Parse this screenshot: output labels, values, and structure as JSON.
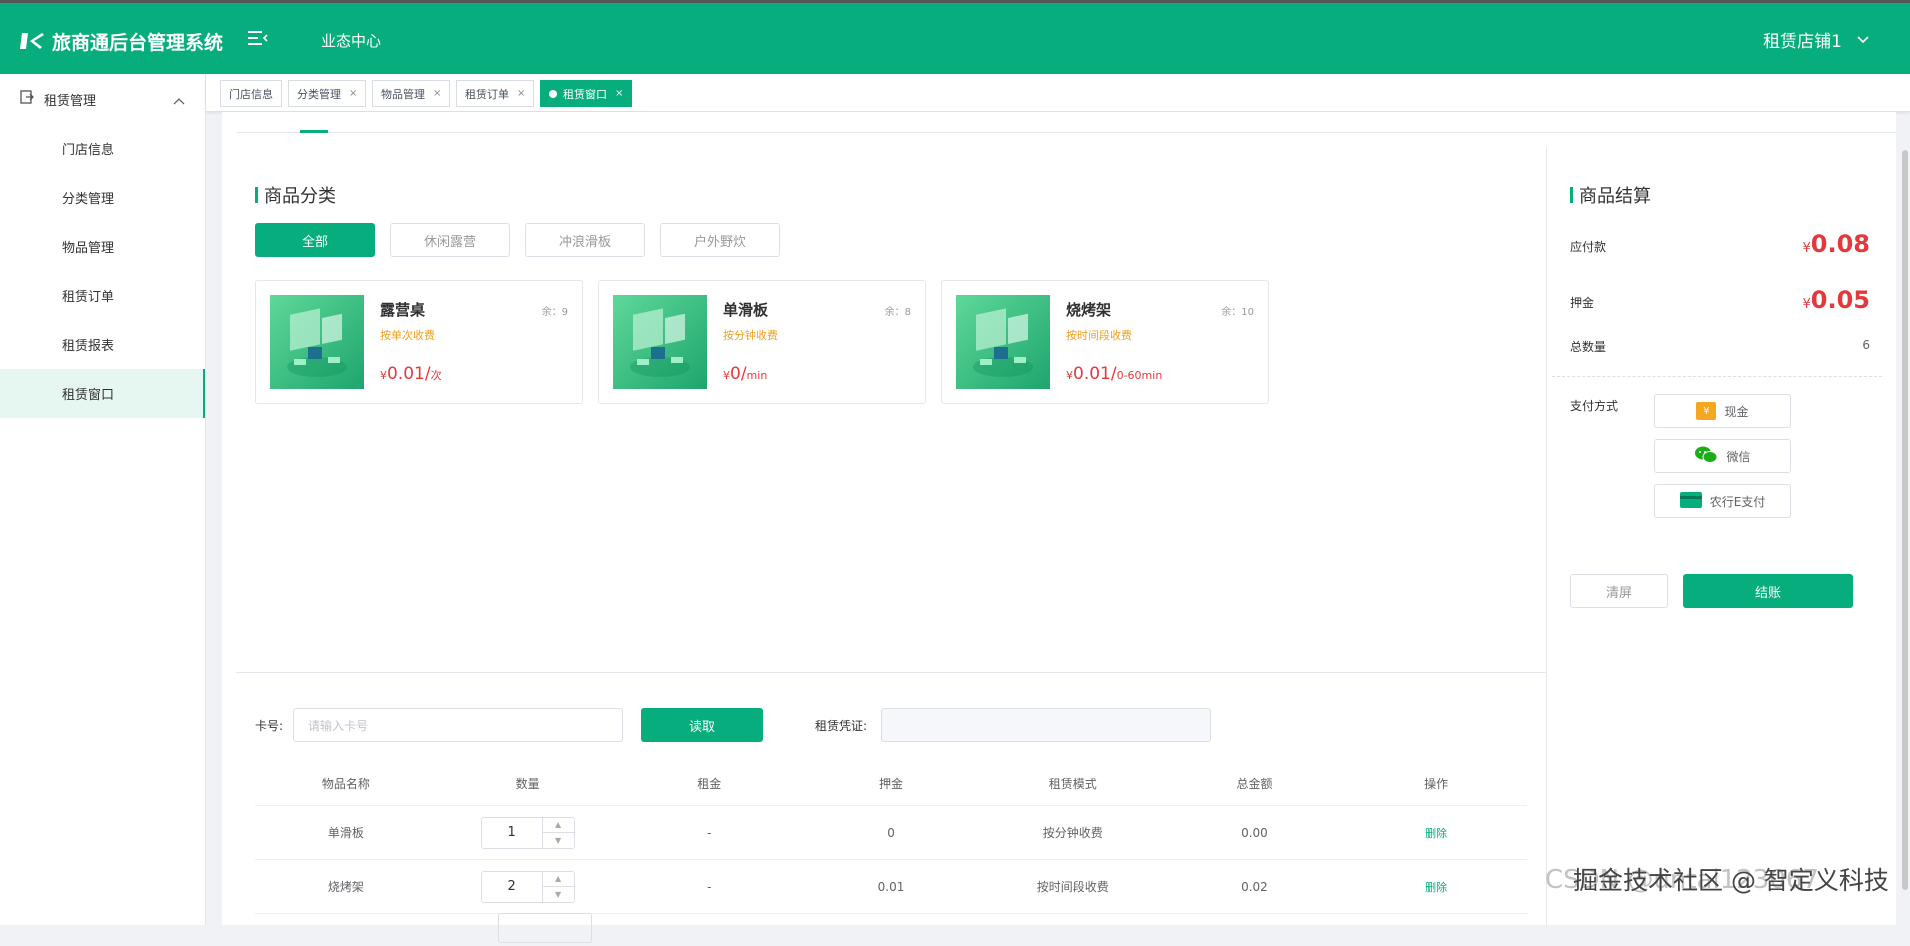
{
  "header": {
    "title": "旅商通后台管理系统",
    "nav_center": "业态中心",
    "user": "租赁店铺1"
  },
  "sidebar": {
    "group": "租赁管理",
    "items": [
      {
        "label": "门店信息"
      },
      {
        "label": "分类管理"
      },
      {
        "label": "物品管理"
      },
      {
        "label": "租赁订单"
      },
      {
        "label": "租赁报表"
      },
      {
        "label": "租赁窗口"
      }
    ],
    "active": "租赁窗口"
  },
  "tabs": [
    {
      "label": "门店信息",
      "closable": false
    },
    {
      "label": "分类管理",
      "closable": true
    },
    {
      "label": "物品管理",
      "closable": true
    },
    {
      "label": "租赁订单",
      "closable": true
    },
    {
      "label": "租赁窗口",
      "closable": true,
      "active": true
    }
  ],
  "goods": {
    "title": "商品分类",
    "categories": [
      "全部",
      "休闲露营",
      "冲浪滑板",
      "户外野炊"
    ],
    "active_category": "全部",
    "cards": [
      {
        "name": "露营桌",
        "stock": "余：9",
        "mode": "按单次收费",
        "currency": "¥",
        "price": "0.01/",
        "unit": "次"
      },
      {
        "name": "单滑板",
        "stock": "余：8",
        "mode": "按分钟收费",
        "currency": "¥",
        "price": "0/",
        "unit": "min"
      },
      {
        "name": "烧烤架",
        "stock": "余：10",
        "mode": "按时间段收费",
        "currency": "¥",
        "price": "0.01/",
        "unit": "0-60min"
      }
    ]
  },
  "form": {
    "card_label": "卡号:",
    "card_placeholder": "请输入卡号",
    "read_button": "读取",
    "voucher_label": "租赁凭证:"
  },
  "table": {
    "columns": [
      "物品名称",
      "数量",
      "租金",
      "押金",
      "租赁模式",
      "总金额",
      "操作"
    ],
    "rows": [
      {
        "name": "单滑板",
        "qty": "1",
        "rent": "-",
        "deposit": "0",
        "mode": "按分钟收费",
        "total": "0.00",
        "action": "删除"
      },
      {
        "name": "烧烤架",
        "qty": "2",
        "rent": "-",
        "deposit": "0.01",
        "mode": "按时间段收费",
        "total": "0.02",
        "action": "删除"
      }
    ]
  },
  "checkout": {
    "title": "商品结算",
    "payable_label": "应付款",
    "payable_currency": "¥",
    "payable_value": "0.08",
    "deposit_label": "押金",
    "deposit_currency": "¥",
    "deposit_value": "0.05",
    "count_label": "总数量",
    "count_value": "6",
    "pay_label": "支付方式",
    "pay_methods": [
      {
        "label": "现金",
        "icon": "cash-icon",
        "badge": "¥"
      },
      {
        "label": "微信",
        "icon": "wechat-icon"
      },
      {
        "label": "农行E支付",
        "icon": "bank-card-icon"
      }
    ],
    "clear_button": "清屏",
    "checkout_button": "结账"
  },
  "watermark": "掘金技术社区 @ 智定义科技",
  "watermark_bg": "CSDN @untal123067",
  "colors": {
    "accent": "#07ad7c",
    "price": "#e4393c",
    "mode": "#f0a020"
  }
}
